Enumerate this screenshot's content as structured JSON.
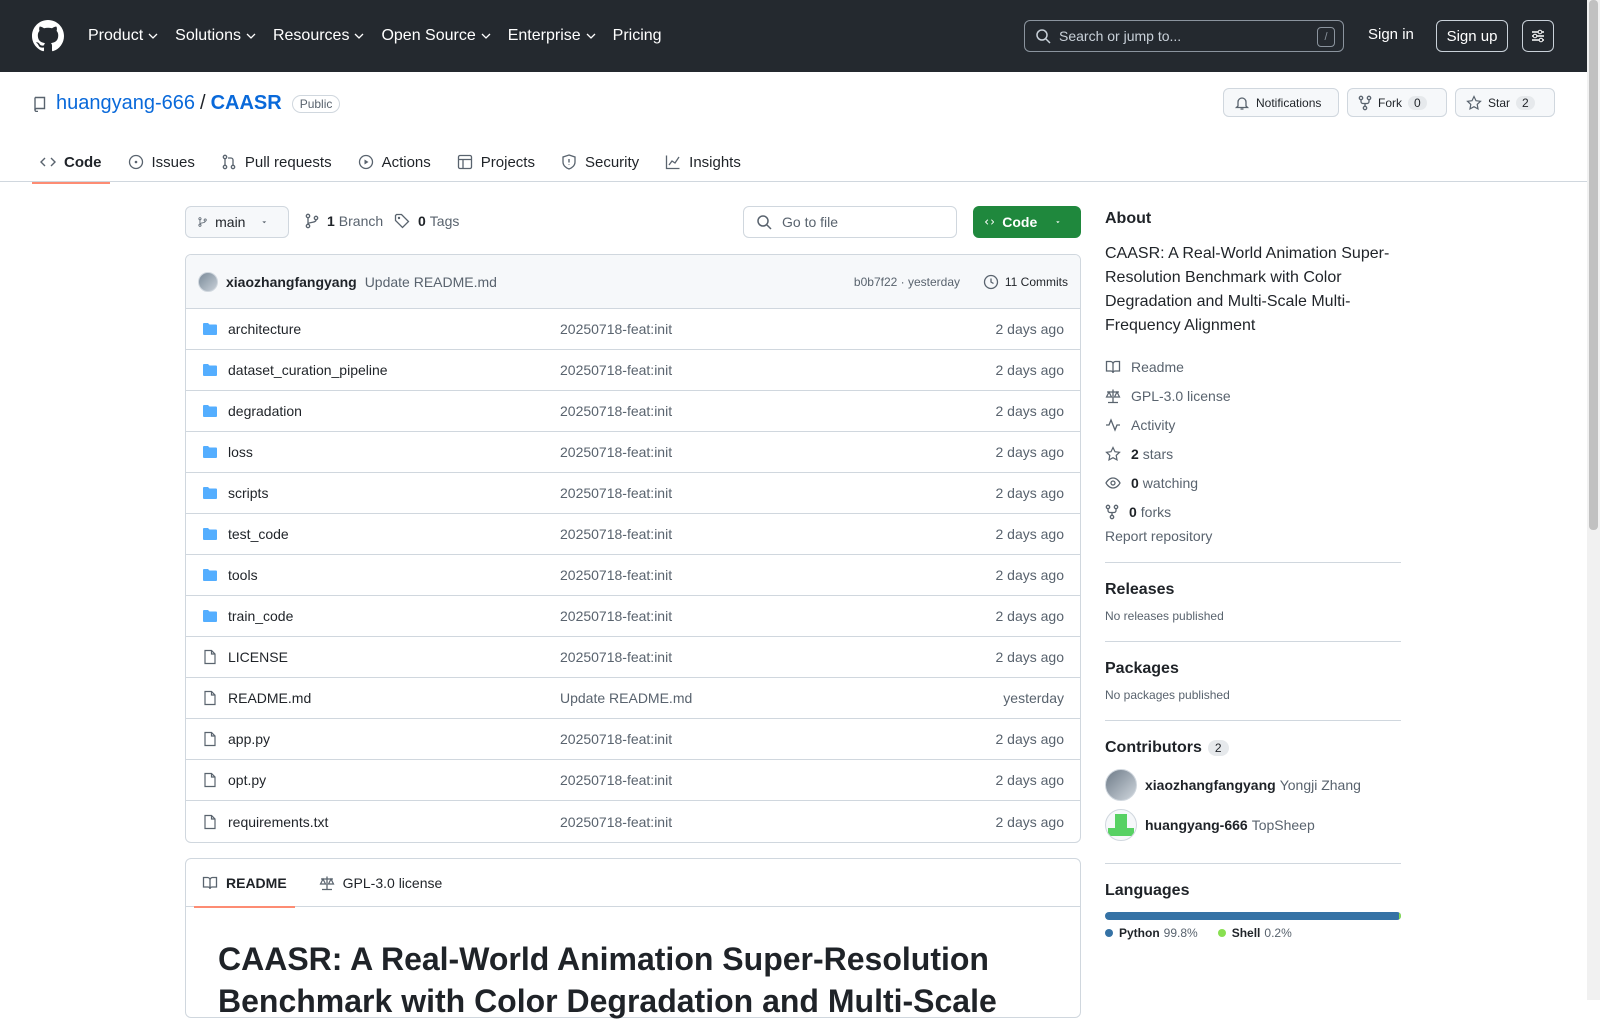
{
  "topnav": {
    "items": [
      {
        "label": "Product",
        "dropdown": true
      },
      {
        "label": "Solutions",
        "dropdown": true
      },
      {
        "label": "Resources",
        "dropdown": true
      },
      {
        "label": "Open Source",
        "dropdown": true
      },
      {
        "label": "Enterprise",
        "dropdown": true
      },
      {
        "label": "Pricing",
        "dropdown": false
      }
    ],
    "search_placeholder": "Search or jump to...",
    "search_shortcut": "/",
    "signin": "Sign in",
    "signup": "Sign up"
  },
  "repo": {
    "owner": "huangyang-666",
    "separator": "/",
    "name": "CAASR",
    "visibility": "Public",
    "notifications_label": "Notifications",
    "fork_label": "Fork",
    "fork_count": "0",
    "star_label": "Star",
    "star_count": "2"
  },
  "tabs": [
    {
      "label": "Code",
      "icon": "code-icon",
      "active": true
    },
    {
      "label": "Issues",
      "icon": "issue-icon",
      "active": false
    },
    {
      "label": "Pull requests",
      "icon": "pull-request-icon",
      "active": false
    },
    {
      "label": "Actions",
      "icon": "play-icon",
      "active": false
    },
    {
      "label": "Projects",
      "icon": "table-icon",
      "active": false
    },
    {
      "label": "Security",
      "icon": "shield-icon",
      "active": false
    },
    {
      "label": "Insights",
      "icon": "graph-icon",
      "active": false
    }
  ],
  "toolbar": {
    "branch": "main",
    "branch_count": "1",
    "branch_label": "Branch",
    "tag_count": "0",
    "tag_label": "Tags",
    "goto_placeholder": "Go to file",
    "code_button": "Code"
  },
  "latest_commit": {
    "author": "xiaozhangfangyang",
    "message": "Update README.md",
    "hash_time": "b0b7f22 · yesterday",
    "commits": "11 Commits"
  },
  "files": [
    {
      "name": "architecture",
      "type": "dir",
      "message": "20250718-feat:init",
      "date": "2 days ago"
    },
    {
      "name": "dataset_curation_pipeline",
      "type": "dir",
      "message": "20250718-feat:init",
      "date": "2 days ago"
    },
    {
      "name": "degradation",
      "type": "dir",
      "message": "20250718-feat:init",
      "date": "2 days ago"
    },
    {
      "name": "loss",
      "type": "dir",
      "message": "20250718-feat:init",
      "date": "2 days ago"
    },
    {
      "name": "scripts",
      "type": "dir",
      "message": "20250718-feat:init",
      "date": "2 days ago"
    },
    {
      "name": "test_code",
      "type": "dir",
      "message": "20250718-feat:init",
      "date": "2 days ago"
    },
    {
      "name": "tools",
      "type": "dir",
      "message": "20250718-feat:init",
      "date": "2 days ago"
    },
    {
      "name": "train_code",
      "type": "dir",
      "message": "20250718-feat:init",
      "date": "2 days ago"
    },
    {
      "name": "LICENSE",
      "type": "file",
      "message": "20250718-feat:init",
      "date": "2 days ago"
    },
    {
      "name": "README.md",
      "type": "file",
      "message": "Update README.md",
      "date": "yesterday"
    },
    {
      "name": "app.py",
      "type": "file",
      "message": "20250718-feat:init",
      "date": "2 days ago"
    },
    {
      "name": "opt.py",
      "type": "file",
      "message": "20250718-feat:init",
      "date": "2 days ago"
    },
    {
      "name": "requirements.txt",
      "type": "file",
      "message": "20250718-feat:init",
      "date": "2 days ago"
    }
  ],
  "readme": {
    "tab_readme": "README",
    "tab_license": "GPL-3.0 license",
    "heading": "CAASR: A Real-World Animation Super-Resolution Benchmark with Color Degradation and Multi-Scale"
  },
  "sidebar": {
    "about_title": "About",
    "about_text": "CAASR: A Real-World Animation Super-Resolution Benchmark with Color Degradation and Multi-Scale Multi-Frequency Alignment",
    "readme": "Readme",
    "license": "GPL-3.0 license",
    "activity": "Activity",
    "stars_count": "2",
    "stars_label": "stars",
    "watching_count": "0",
    "watching_label": "watching",
    "forks_count": "0",
    "forks_label": "forks",
    "report": "Report repository",
    "releases_title": "Releases",
    "releases_text": "No releases published",
    "packages_title": "Packages",
    "packages_text": "No packages published",
    "contributors_title": "Contributors",
    "contributors_count": "2",
    "contributors": [
      {
        "login": "xiaozhangfangyang",
        "name": "Yongji Zhang"
      },
      {
        "login": "huangyang-666",
        "name": "TopSheep"
      }
    ],
    "languages_title": "Languages",
    "languages": [
      {
        "name": "Python",
        "percent": "99.8%",
        "color": "#3572A5"
      },
      {
        "name": "Shell",
        "percent": "0.2%",
        "color": "#89e051"
      }
    ]
  }
}
